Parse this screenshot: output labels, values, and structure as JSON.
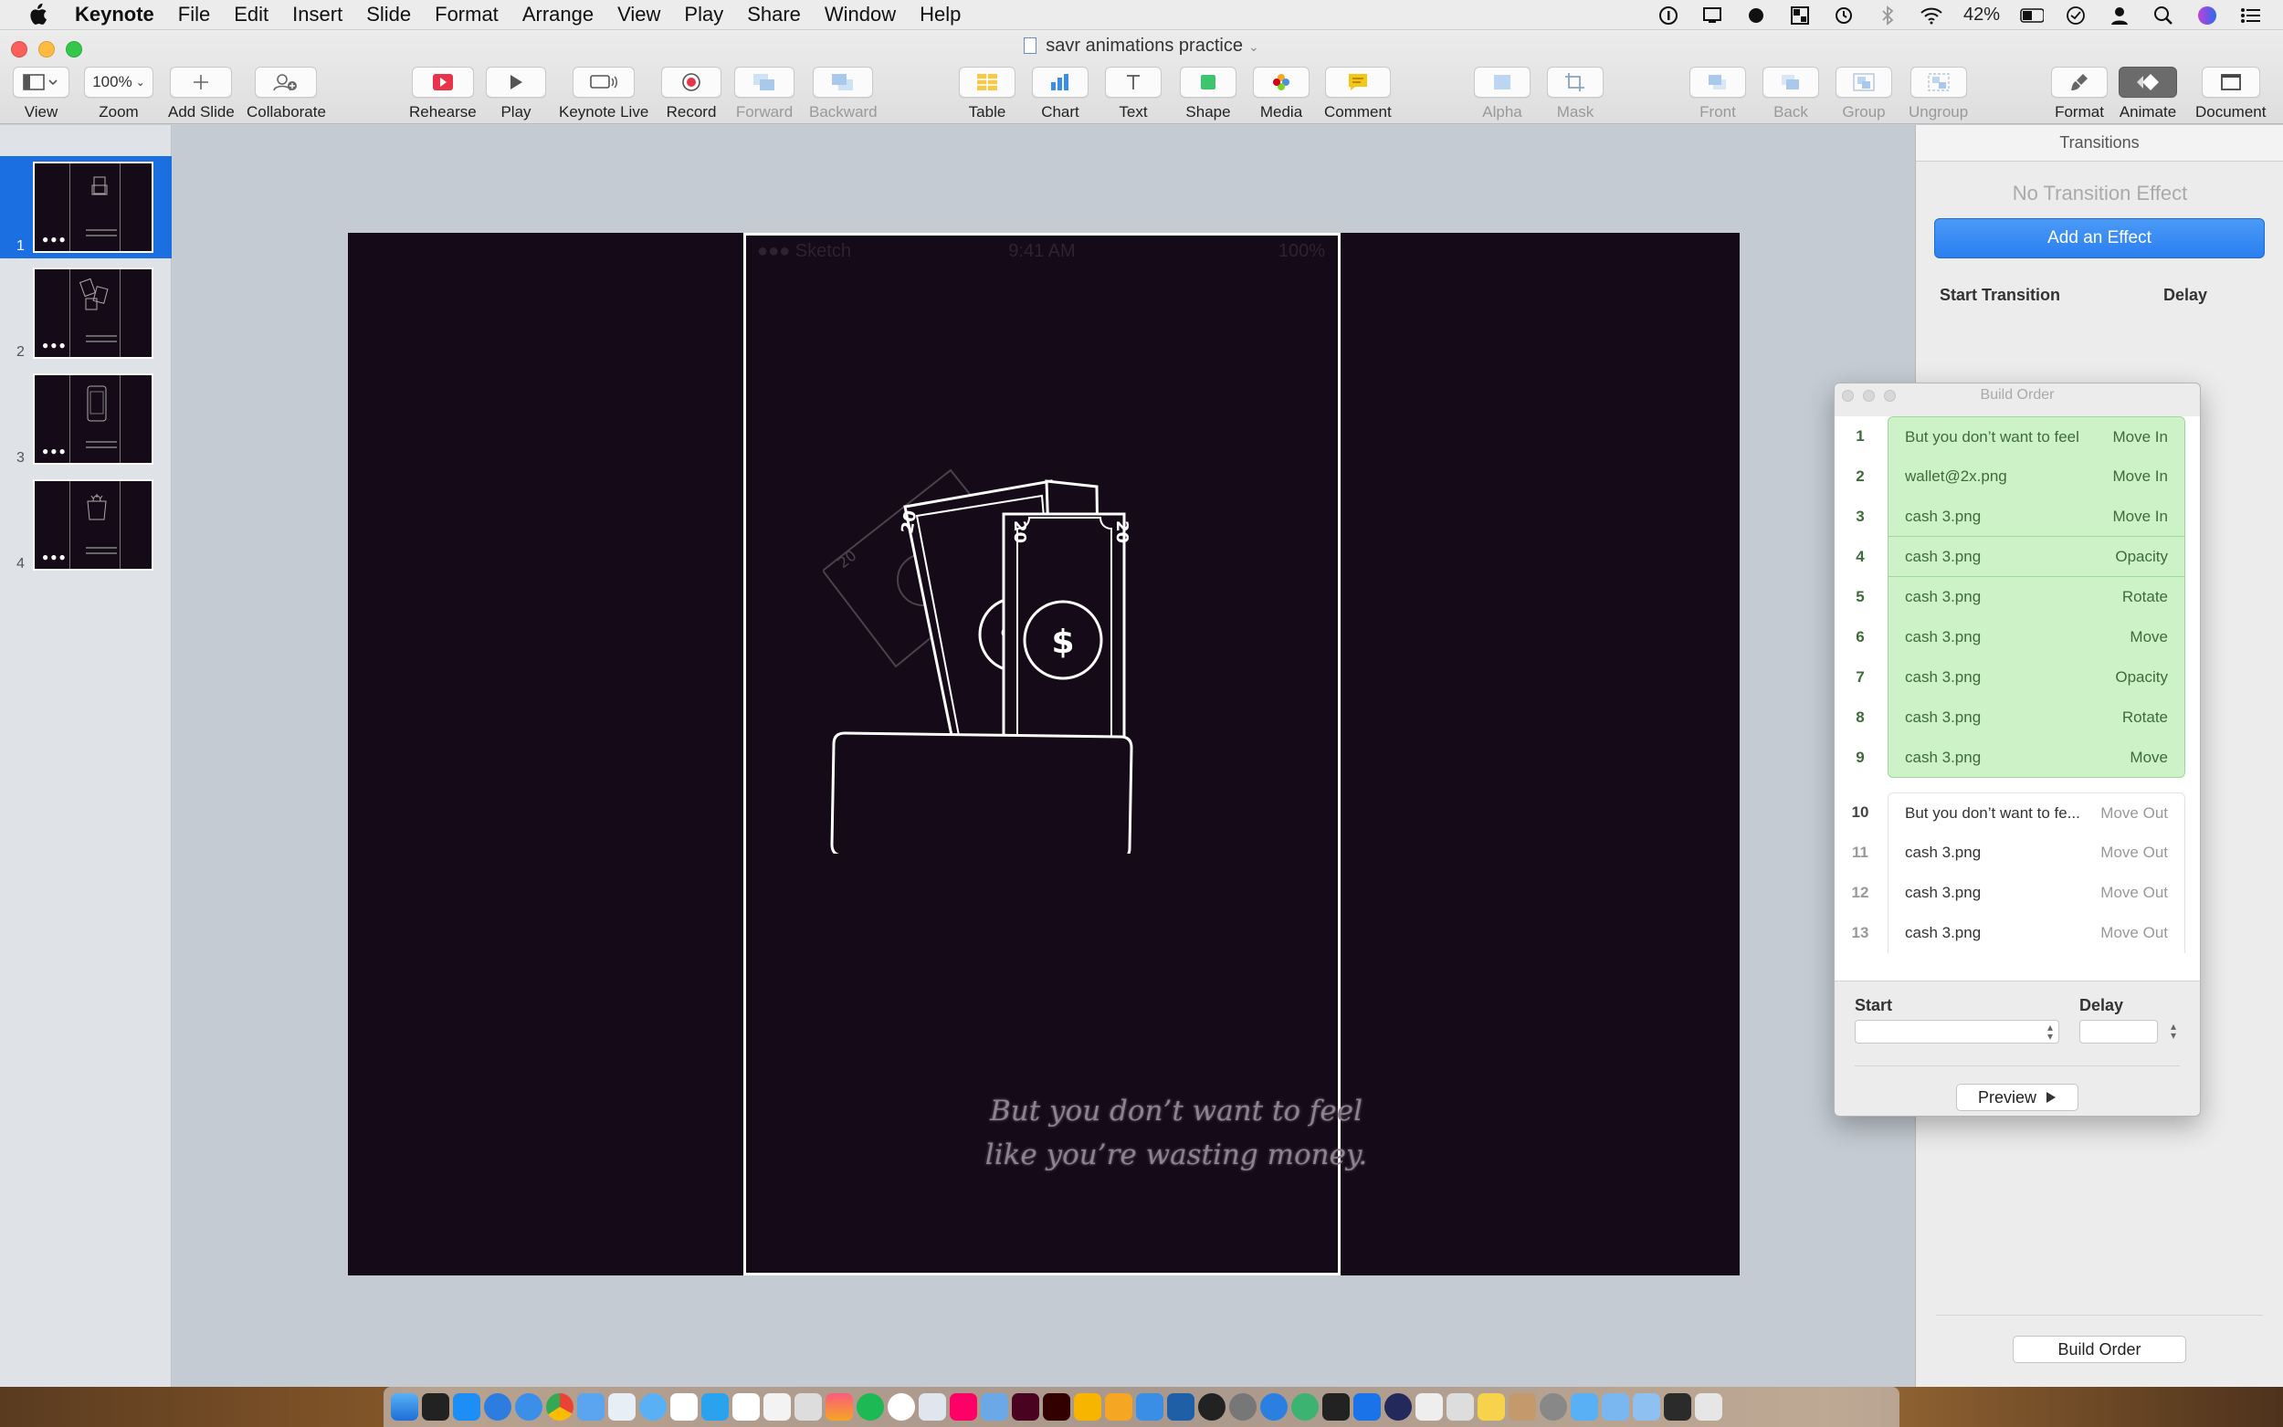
{
  "menubar": {
    "app_name": "Keynote",
    "items": [
      "File",
      "Edit",
      "Insert",
      "Slide",
      "Format",
      "Arrange",
      "View",
      "Play",
      "Share",
      "Window",
      "Help"
    ],
    "battery": "42%"
  },
  "window": {
    "title": "savr animations practice"
  },
  "toolbar": {
    "view": "View",
    "zoom_value": "100%",
    "zoom": "Zoom",
    "add_slide": "Add Slide",
    "collaborate": "Collaborate",
    "rehearse": "Rehearse",
    "play": "Play",
    "keynote_live": "Keynote Live",
    "record": "Record",
    "forward": "Forward",
    "backward": "Backward",
    "table": "Table",
    "chart": "Chart",
    "text": "Text",
    "shape": "Shape",
    "media": "Media",
    "comment": "Comment",
    "alpha": "Alpha",
    "mask": "Mask",
    "front": "Front",
    "back": "Back",
    "group": "Group",
    "ungroup": "Ungroup",
    "format": "Format",
    "animate": "Animate",
    "document": "Document"
  },
  "navigator": {
    "slides": [
      "1",
      "2",
      "3",
      "4"
    ],
    "selected": "1"
  },
  "slide": {
    "status_left": "●●● Sketch",
    "status_time": "9:41 AM",
    "status_right": "100%",
    "bill_denomination": "20",
    "text_line1": "But you don’t want to feel",
    "text_line2": "like you’re wasting money."
  },
  "inspector": {
    "tab": "Transitions",
    "no_effect": "No Transition Effect",
    "add_effect": "Add an Effect",
    "start_transition": "Start Transition",
    "delay": "Delay",
    "build_order_button": "Build Order"
  },
  "build_order": {
    "title": "Build Order",
    "rows": [
      {
        "num": "1",
        "name": "But you don’t want to feel",
        "effect": "Move In",
        "style": "green"
      },
      {
        "num": "2",
        "name": "wallet@2x.png",
        "effect": "Move In",
        "style": "green"
      },
      {
        "num": "3",
        "name": "cash 3.png",
        "effect": "Move In",
        "style": "green"
      },
      {
        "num": "4",
        "name": "cash 3.png",
        "effect": "Opacity",
        "style": "green"
      },
      {
        "num": "5",
        "name": "cash 3.png",
        "effect": "Rotate",
        "style": "green"
      },
      {
        "num": "6",
        "name": "cash 3.png",
        "effect": "Move",
        "style": "green"
      },
      {
        "num": "7",
        "name": "cash 3.png",
        "effect": "Opacity",
        "style": "green"
      },
      {
        "num": "8",
        "name": "cash 3.png",
        "effect": "Rotate",
        "style": "green"
      },
      {
        "num": "9",
        "name": "cash 3.png",
        "effect": "Move",
        "style": "green"
      },
      {
        "num": "10",
        "name": "But you don’t want to fe...",
        "effect": "Move Out",
        "style": "plain"
      },
      {
        "num": "11",
        "name": "cash 3.png",
        "effect": "Move Out",
        "style": "plain"
      },
      {
        "num": "12",
        "name": "cash 3.png",
        "effect": "Move Out",
        "style": "plain"
      },
      {
        "num": "13",
        "name": "cash 3.png",
        "effect": "Move Out",
        "style": "plain"
      }
    ],
    "start_label": "Start",
    "delay_label": "Delay",
    "preview": "Preview"
  },
  "colors": {
    "accent": "#1b6fe0",
    "slide_bg": "#150a18",
    "build_green": "#cdf2c8"
  }
}
